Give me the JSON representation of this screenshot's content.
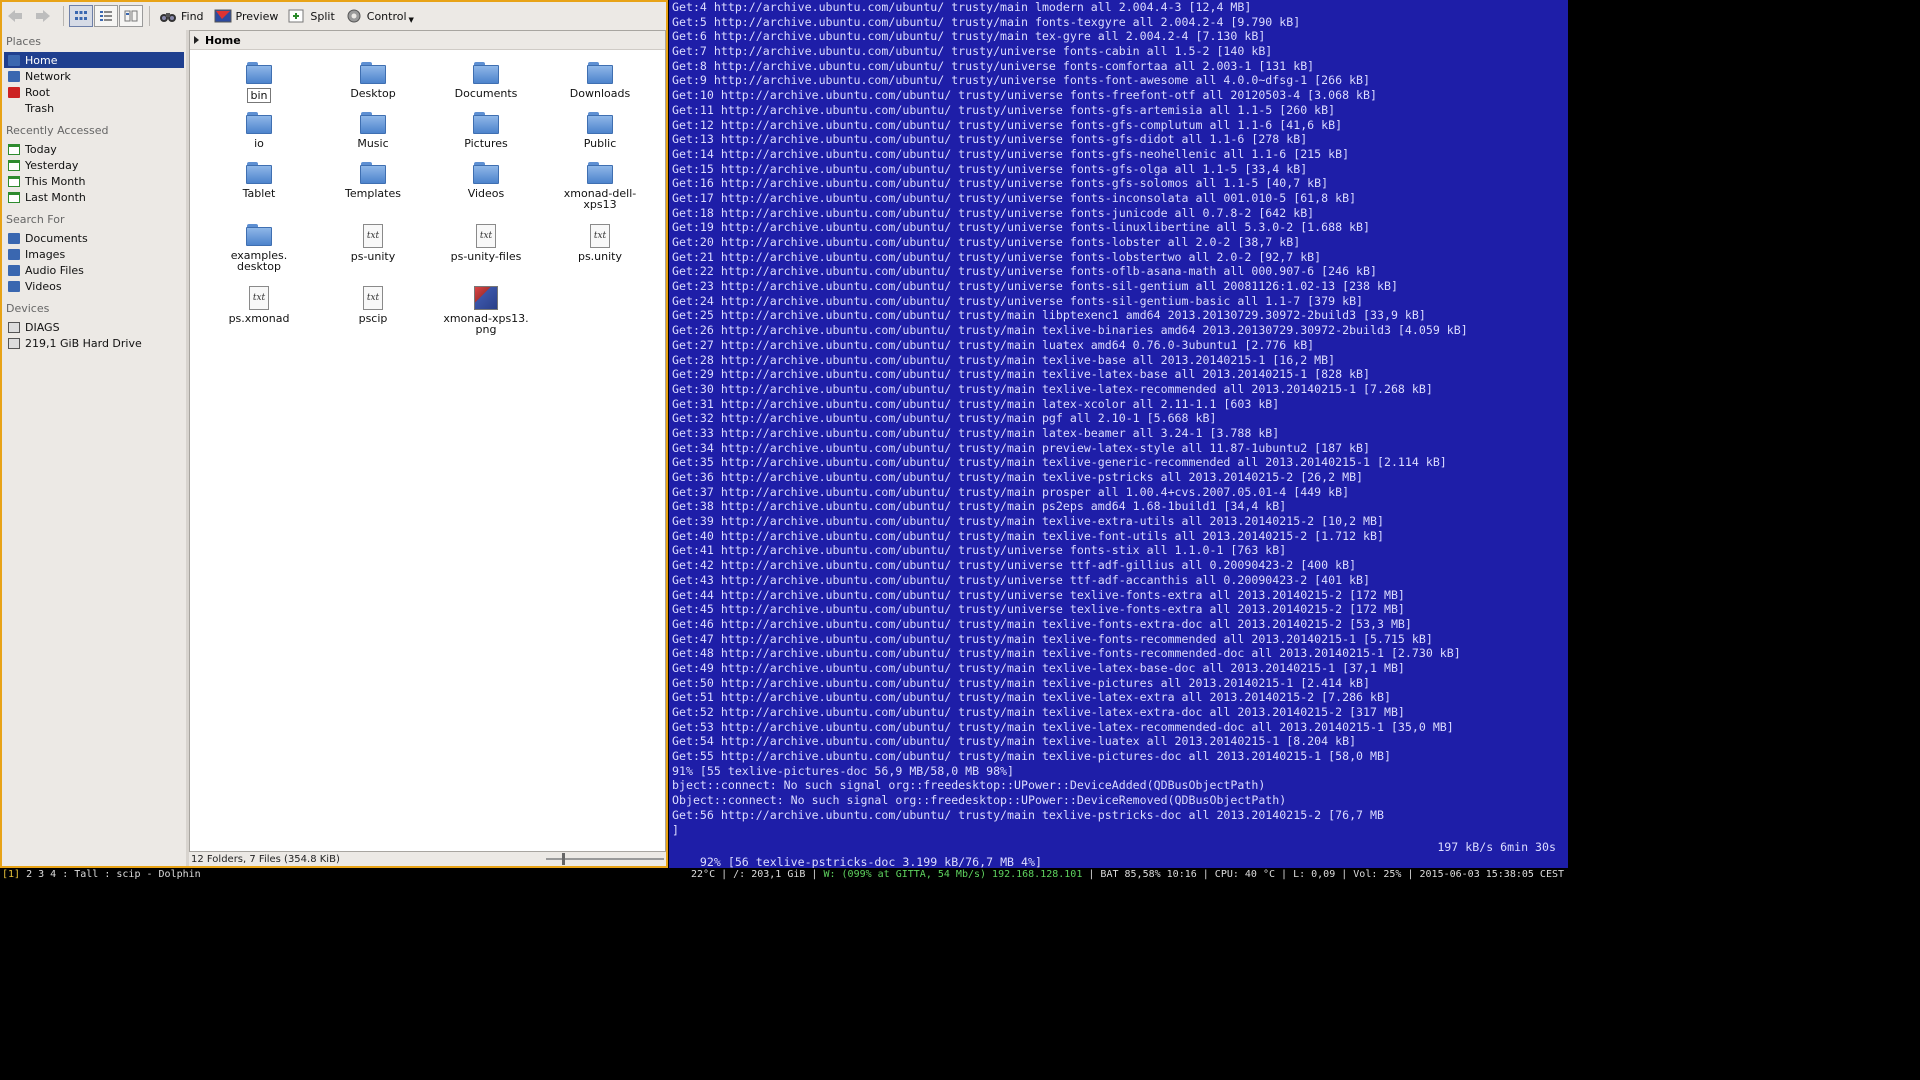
{
  "dolphin": {
    "toolbar": {
      "find": "Find",
      "preview": "Preview",
      "split": "Split",
      "control": "Control"
    },
    "places": {
      "sections": [
        {
          "title": "Places",
          "items": [
            {
              "label": "Home",
              "icon": "home-icon",
              "selected": true
            },
            {
              "label": "Network",
              "icon": "network-icon"
            },
            {
              "label": "Root",
              "icon": "root-folder-icon"
            },
            {
              "label": "Trash",
              "icon": "trash-icon"
            }
          ]
        },
        {
          "title": "Recently Accessed",
          "items": [
            {
              "label": "Today",
              "icon": "calendar-icon"
            },
            {
              "label": "Yesterday",
              "icon": "calendar-icon"
            },
            {
              "label": "This Month",
              "icon": "calendar-icon"
            },
            {
              "label": "Last Month",
              "icon": "calendar-icon"
            }
          ]
        },
        {
          "title": "Search For",
          "items": [
            {
              "label": "Documents",
              "icon": "documents-icon"
            },
            {
              "label": "Images",
              "icon": "images-icon"
            },
            {
              "label": "Audio Files",
              "icon": "audio-icon"
            },
            {
              "label": "Videos",
              "icon": "videos-icon"
            }
          ]
        },
        {
          "title": "Devices",
          "items": [
            {
              "label": "DIAGS",
              "icon": "drive-icon"
            },
            {
              "label": "219,1 GiB Hard Drive",
              "icon": "drive-icon"
            }
          ]
        }
      ]
    },
    "breadcrumb": "Home",
    "files": [
      {
        "name": "bin",
        "type": "folder",
        "selected": true
      },
      {
        "name": "Desktop",
        "type": "folder"
      },
      {
        "name": "Documents",
        "type": "folder"
      },
      {
        "name": "Downloads",
        "type": "folder"
      },
      {
        "name": "io",
        "type": "folder"
      },
      {
        "name": "Music",
        "type": "folder"
      },
      {
        "name": "Pictures",
        "type": "folder"
      },
      {
        "name": "Public",
        "type": "folder"
      },
      {
        "name": "Tablet",
        "type": "folder"
      },
      {
        "name": "Templates",
        "type": "folder"
      },
      {
        "name": "Videos",
        "type": "folder"
      },
      {
        "name": "xmonad-dell-\nxps13",
        "type": "folder"
      },
      {
        "name": "examples.\ndesktop",
        "type": "folder"
      },
      {
        "name": "ps-unity",
        "type": "txt"
      },
      {
        "name": "ps-unity-files",
        "type": "txt"
      },
      {
        "name": "ps.unity",
        "type": "txt"
      },
      {
        "name": "ps.xmonad",
        "type": "txt"
      },
      {
        "name": "pscip",
        "type": "txt"
      },
      {
        "name": "xmonad-xps13.\npng",
        "type": "png"
      }
    ],
    "status": "12 Folders, 7 Files (354.8 KiB)"
  },
  "terminal": {
    "lines": [
      "Get:4 http://archive.ubuntu.com/ubuntu/ trusty/main lmodern all 2.004.4-3 [12,4 MB]",
      "Get:5 http://archive.ubuntu.com/ubuntu/ trusty/main fonts-texgyre all 2.004.2-4 [9.790 kB]",
      "Get:6 http://archive.ubuntu.com/ubuntu/ trusty/main tex-gyre all 2.004.2-4 [7.130 kB]",
      "Get:7 http://archive.ubuntu.com/ubuntu/ trusty/universe fonts-cabin all 1.5-2 [140 kB]",
      "Get:8 http://archive.ubuntu.com/ubuntu/ trusty/universe fonts-comfortaa all 2.003-1 [131 kB]",
      "Get:9 http://archive.ubuntu.com/ubuntu/ trusty/universe fonts-font-awesome all 4.0.0~dfsg-1 [266 kB]",
      "Get:10 http://archive.ubuntu.com/ubuntu/ trusty/universe fonts-freefont-otf all 20120503-4 [3.068 kB]",
      "Get:11 http://archive.ubuntu.com/ubuntu/ trusty/universe fonts-gfs-artemisia all 1.1-5 [260 kB]",
      "Get:12 http://archive.ubuntu.com/ubuntu/ trusty/universe fonts-gfs-complutum all 1.1-6 [41,6 kB]",
      "Get:13 http://archive.ubuntu.com/ubuntu/ trusty/universe fonts-gfs-didot all 1.1-6 [278 kB]",
      "Get:14 http://archive.ubuntu.com/ubuntu/ trusty/universe fonts-gfs-neohellenic all 1.1-6 [215 kB]",
      "Get:15 http://archive.ubuntu.com/ubuntu/ trusty/universe fonts-gfs-olga all 1.1-5 [33,4 kB]",
      "Get:16 http://archive.ubuntu.com/ubuntu/ trusty/universe fonts-gfs-solomos all 1.1-5 [40,7 kB]",
      "Get:17 http://archive.ubuntu.com/ubuntu/ trusty/universe fonts-inconsolata all 001.010-5 [61,8 kB]",
      "Get:18 http://archive.ubuntu.com/ubuntu/ trusty/universe fonts-junicode all 0.7.8-2 [642 kB]",
      "Get:19 http://archive.ubuntu.com/ubuntu/ trusty/universe fonts-linuxlibertine all 5.3.0-2 [1.688 kB]",
      "Get:20 http://archive.ubuntu.com/ubuntu/ trusty/universe fonts-lobster all 2.0-2 [38,7 kB]",
      "Get:21 http://archive.ubuntu.com/ubuntu/ trusty/universe fonts-lobstertwo all 2.0-2 [92,7 kB]",
      "Get:22 http://archive.ubuntu.com/ubuntu/ trusty/universe fonts-oflb-asana-math all 000.907-6 [246 kB]",
      "Get:23 http://archive.ubuntu.com/ubuntu/ trusty/universe fonts-sil-gentium all 20081126:1.02-13 [238 kB]",
      "Get:24 http://archive.ubuntu.com/ubuntu/ trusty/universe fonts-sil-gentium-basic all 1.1-7 [379 kB]",
      "Get:25 http://archive.ubuntu.com/ubuntu/ trusty/main libptexenc1 amd64 2013.20130729.30972-2build3 [33,9 kB]",
      "Get:26 http://archive.ubuntu.com/ubuntu/ trusty/main texlive-binaries amd64 2013.20130729.30972-2build3 [4.059 kB]",
      "Get:27 http://archive.ubuntu.com/ubuntu/ trusty/main luatex amd64 0.76.0-3ubuntu1 [2.776 kB]",
      "Get:28 http://archive.ubuntu.com/ubuntu/ trusty/main texlive-base all 2013.20140215-1 [16,2 MB]",
      "Get:29 http://archive.ubuntu.com/ubuntu/ trusty/main texlive-latex-base all 2013.20140215-1 [828 kB]",
      "Get:30 http://archive.ubuntu.com/ubuntu/ trusty/main texlive-latex-recommended all 2013.20140215-1 [7.268 kB]",
      "Get:31 http://archive.ubuntu.com/ubuntu/ trusty/main latex-xcolor all 2.11-1.1 [603 kB]",
      "Get:32 http://archive.ubuntu.com/ubuntu/ trusty/main pgf all 2.10-1 [5.668 kB]",
      "Get:33 http://archive.ubuntu.com/ubuntu/ trusty/main latex-beamer all 3.24-1 [3.788 kB]",
      "Get:34 http://archive.ubuntu.com/ubuntu/ trusty/main preview-latex-style all 11.87-1ubuntu2 [187 kB]",
      "Get:35 http://archive.ubuntu.com/ubuntu/ trusty/main texlive-generic-recommended all 2013.20140215-1 [2.114 kB]",
      "Get:36 http://archive.ubuntu.com/ubuntu/ trusty/main texlive-pstricks all 2013.20140215-2 [26,2 MB]",
      "Get:37 http://archive.ubuntu.com/ubuntu/ trusty/main prosper all 1.00.4+cvs.2007.05.01-4 [449 kB]",
      "Get:38 http://archive.ubuntu.com/ubuntu/ trusty/main ps2eps amd64 1.68-1build1 [34,4 kB]",
      "Get:39 http://archive.ubuntu.com/ubuntu/ trusty/main texlive-extra-utils all 2013.20140215-2 [10,2 MB]",
      "Get:40 http://archive.ubuntu.com/ubuntu/ trusty/main texlive-font-utils all 2013.20140215-2 [1.712 kB]",
      "Get:41 http://archive.ubuntu.com/ubuntu/ trusty/universe fonts-stix all 1.1.0-1 [763 kB]",
      "Get:42 http://archive.ubuntu.com/ubuntu/ trusty/universe ttf-adf-gillius all 0.20090423-2 [400 kB]",
      "Get:43 http://archive.ubuntu.com/ubuntu/ trusty/universe ttf-adf-accanthis all 0.20090423-2 [401 kB]",
      "Get:44 http://archive.ubuntu.com/ubuntu/ trusty/universe texlive-fonts-extra all 2013.20140215-2 [172 MB]",
      "Get:45 http://archive.ubuntu.com/ubuntu/ trusty/universe texlive-fonts-extra all 2013.20140215-2 [172 MB]",
      "Get:46 http://archive.ubuntu.com/ubuntu/ trusty/main texlive-fonts-extra-doc all 2013.20140215-2 [53,3 MB]",
      "Get:47 http://archive.ubuntu.com/ubuntu/ trusty/main texlive-fonts-recommended all 2013.20140215-1 [5.715 kB]",
      "Get:48 http://archive.ubuntu.com/ubuntu/ trusty/main texlive-fonts-recommended-doc all 2013.20140215-1 [2.730 kB]",
      "Get:49 http://archive.ubuntu.com/ubuntu/ trusty/main texlive-latex-base-doc all 2013.20140215-1 [37,1 MB]",
      "Get:50 http://archive.ubuntu.com/ubuntu/ trusty/main texlive-pictures all 2013.20140215-1 [2.414 kB]",
      "Get:51 http://archive.ubuntu.com/ubuntu/ trusty/main texlive-latex-extra all 2013.20140215-2 [7.286 kB]",
      "Get:52 http://archive.ubuntu.com/ubuntu/ trusty/main texlive-latex-extra-doc all 2013.20140215-2 [317 MB]",
      "Get:53 http://archive.ubuntu.com/ubuntu/ trusty/main texlive-latex-recommended-doc all 2013.20140215-1 [35,0 MB]",
      "Get:54 http://archive.ubuntu.com/ubuntu/ trusty/main texlive-luatex all 2013.20140215-1 [8.204 kB]",
      "Get:55 http://archive.ubuntu.com/ubuntu/ trusty/main texlive-pictures-doc all 2013.20140215-1 [58,0 MB]",
      "91% [55 texlive-pictures-doc 56,9 MB/58,0 MB 98%]",
      "bject::connect: No such signal org::freedesktop::UPower::DeviceAdded(QDBusObjectPath)",
      "Object::connect: No such signal org::freedesktop::UPower::DeviceRemoved(QDBusObjectPath)",
      "Get:56 http://archive.ubuntu.com/ubuntu/ trusty/main texlive-pstricks-doc all 2013.20140215-2 [76,7 MB",
      "]"
    ],
    "progress": "92% [56 texlive-pstricks-doc 3.199 kB/76,7 MB 4%]",
    "rate": "197 kB/s 6min 30s"
  },
  "statusbar": {
    "left_active": "[1]",
    "left_rest": " 2 3 4 : Tall : scip - Dolphin",
    "temp": "22°C | /: 203,1 GiB | ",
    "wifi": "W: (099% at GITTA, 54 Mb/s) 192.168.128.101",
    "rest": " | BAT 85,58% 10:16 | CPU: 40 °C | L: 0,09 | Vol: 25% | 2015-06-03 15:38:05 CEST"
  },
  "colors": {
    "terminal_bg": "#1e1ea8",
    "selection": "#1f3f8f",
    "window_border": "#e8a317",
    "folder": "#4d83cc"
  }
}
